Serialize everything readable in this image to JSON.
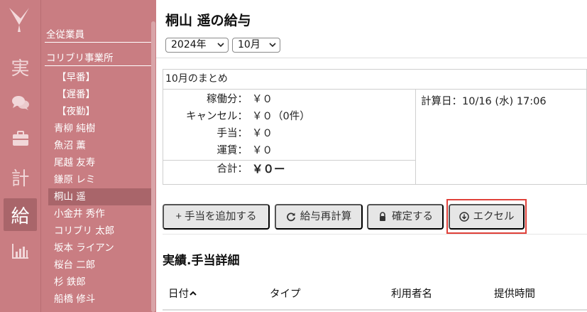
{
  "rail": {
    "items": [
      {
        "name": "rail-jisseki",
        "label": "実"
      },
      {
        "name": "rail-chat",
        "icon": "chat-bubbles-icon"
      },
      {
        "name": "rail-work",
        "icon": "briefcase-icon"
      },
      {
        "name": "rail-keikaku",
        "label": "計"
      },
      {
        "name": "rail-kyuyo",
        "label": "給",
        "active": true
      },
      {
        "name": "rail-stats",
        "icon": "bar-chart-icon"
      }
    ],
    "color": "#c97d82",
    "active_color": "#a9656a"
  },
  "employees": {
    "all_label": "全従業員",
    "office_label": "コリブリ事業所",
    "shifts": [
      "【早番】",
      "【遅番】",
      "【夜勤】"
    ],
    "people": [
      "青柳 純樹",
      "魚沼 薫",
      "尾越 友寿",
      "鎌原 レミ",
      "桐山 遥",
      "小金井 秀作",
      "コリブリ 太郎",
      "坂本 ライアン",
      "桜台 二郎",
      "杉 鉄郎",
      "船橋 修斗"
    ],
    "selected": "桐山 遥"
  },
  "main": {
    "title": "桐山 遥の給与",
    "year_select": "2024年",
    "month_select": "10月",
    "summary": {
      "header": "10月のまとめ",
      "rows": [
        {
          "label": "稼働分：",
          "value": "￥０"
        },
        {
          "label": "キャンセル：",
          "value": "￥０（0件）"
        },
        {
          "label": "手当：",
          "value": "￥０"
        },
        {
          "label": "運賃：",
          "value": "￥０"
        }
      ],
      "total_label": "合計：",
      "total_value": "￥０ー",
      "calc_date": "計算日：10/16 (水) 17:06"
    },
    "buttons": {
      "add_allowance": "+ 手当を追加する",
      "recalc": "給与再計算",
      "confirm": "確定する",
      "excel": "エクセル"
    },
    "section_title": "実績.手当詳細",
    "table_headers": {
      "date": "日付",
      "type": "タイプ",
      "user": "利用者名",
      "time": "提供時間"
    }
  }
}
